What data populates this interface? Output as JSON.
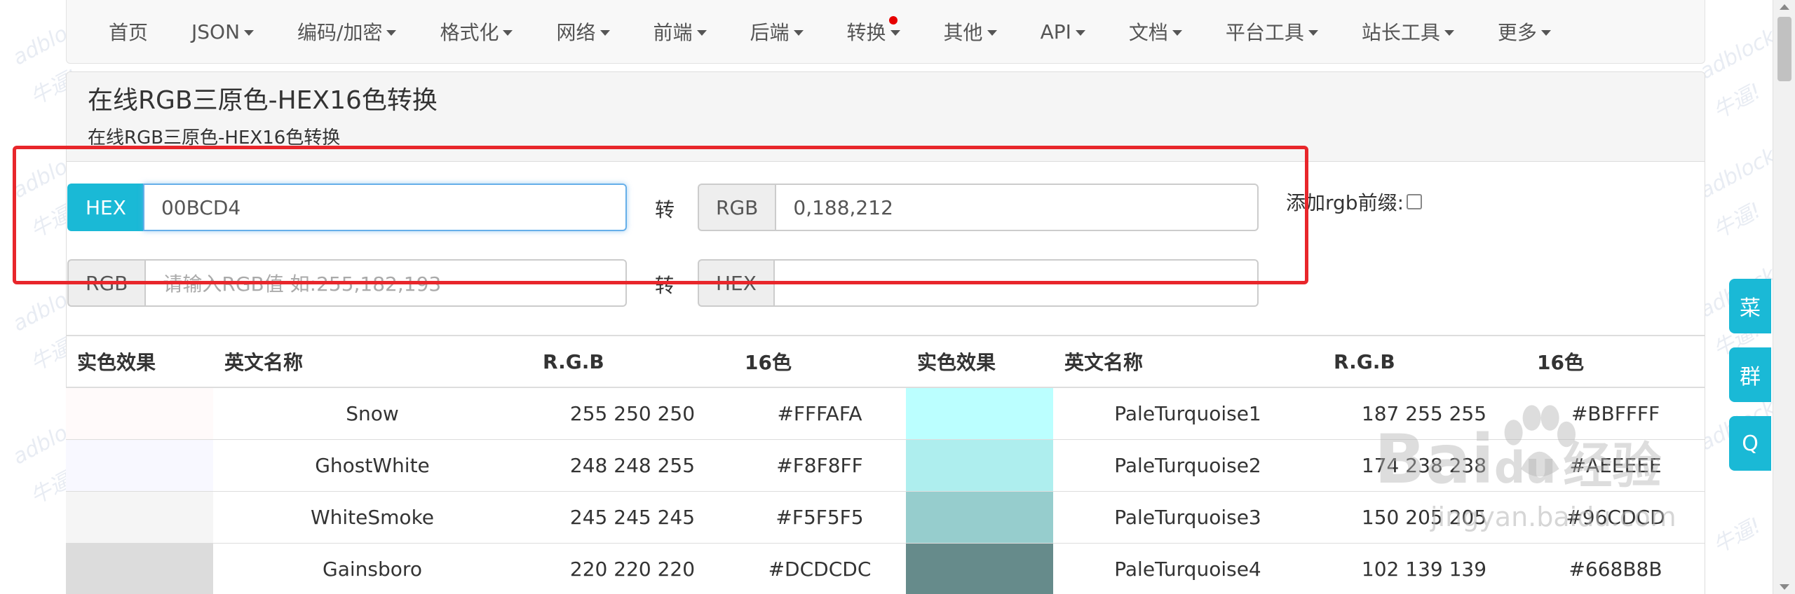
{
  "nav": {
    "items": [
      {
        "label": "首页",
        "dropdown": false
      },
      {
        "label": "JSON",
        "dropdown": true
      },
      {
        "label": "编码/加密",
        "dropdown": true
      },
      {
        "label": "格式化",
        "dropdown": true
      },
      {
        "label": "网络",
        "dropdown": true
      },
      {
        "label": "前端",
        "dropdown": true
      },
      {
        "label": "后端",
        "dropdown": true
      },
      {
        "label": "转换",
        "dropdown": true,
        "badge": true
      },
      {
        "label": "其他",
        "dropdown": true
      },
      {
        "label": "API",
        "dropdown": true
      },
      {
        "label": "文档",
        "dropdown": true
      },
      {
        "label": "平台工具",
        "dropdown": true
      },
      {
        "label": "站长工具",
        "dropdown": true
      },
      {
        "label": "更多",
        "dropdown": true
      }
    ]
  },
  "panel": {
    "title": "在线RGB三原色-HEX16色转换",
    "subtitle": "在线RGB三原色-HEX16色转换"
  },
  "converter": {
    "row1": {
      "left_addon": "HEX",
      "left_value": "00BCD4",
      "arrow": "转",
      "right_addon": "RGB",
      "right_value": "0,188,212"
    },
    "row2": {
      "left_addon": "RGB",
      "left_placeholder": "请输入RGB值 如:255,182,193",
      "arrow": "转",
      "right_addon": "HEX",
      "right_value": ""
    },
    "prefix_label": "添加rgb前缀:"
  },
  "table": {
    "headers": [
      "实色效果",
      "英文名称",
      "R.G.B",
      "16色",
      "实色效果",
      "英文名称",
      "R.G.B",
      "16色"
    ],
    "rows": [
      {
        "swatch1": "#FFFAFA",
        "name1": "Snow",
        "rgb1": "255 250 250",
        "hex1": "#FFFAFA",
        "swatch2": "#BBFFFF",
        "name2": "PaleTurquoise1",
        "rgb2": "187 255 255",
        "hex2": "#BBFFFF"
      },
      {
        "swatch1": "#F8F8FF",
        "name1": "GhostWhite",
        "rgb1": "248 248 255",
        "hex1": "#F8F8FF",
        "swatch2": "#AEEEEE",
        "name2": "PaleTurquoise2",
        "rgb2": "174 238 238",
        "hex2": "#AEEEEE"
      },
      {
        "swatch1": "#F5F5F5",
        "name1": "WhiteSmoke",
        "rgb1": "245 245 245",
        "hex1": "#F5F5F5",
        "swatch2": "#96CDCD",
        "name2": "PaleTurquoise3",
        "rgb2": "150 205 205",
        "hex2": "#96CDCD"
      },
      {
        "swatch1": "#DCDCDC",
        "name1": "Gainsboro",
        "rgb1": "220 220 220",
        "hex1": "#DCDCDC",
        "swatch2": "#668B8B",
        "name2": "PaleTurquoise4",
        "rgb2": "102 139 139",
        "hex2": "#668B8B"
      }
    ]
  },
  "side_buttons": [
    "菜",
    "群",
    "Q"
  ],
  "watermark": {
    "text1": "adblock",
    "text2": "牛逼!",
    "baidu1": "Bai",
    "baidu2": "du",
    "baidu3": "经验",
    "baidu_url": "jingyan.baidu.com"
  },
  "colors": {
    "accent": "#1ab9d6",
    "red_box": "#e8262b"
  }
}
